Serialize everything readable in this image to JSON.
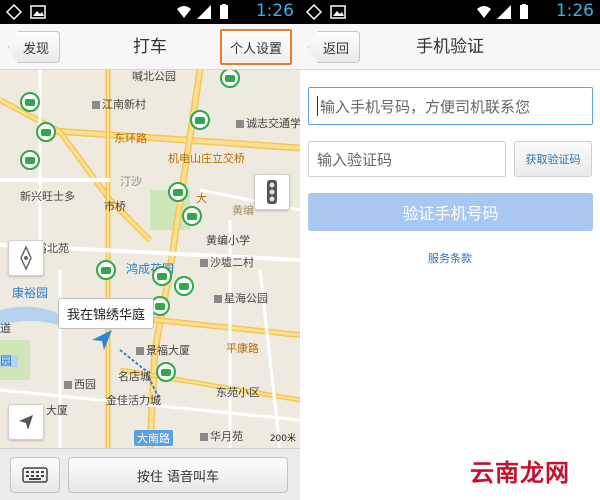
{
  "status_bar": {
    "time": "1:26"
  },
  "left_screen": {
    "nav": {
      "back_label": "发现",
      "title": "打车",
      "settings_label": "个人设置"
    },
    "map": {
      "labels": {
        "top_park": "喊北公园",
        "jiangnan": "江南新村",
        "dongpu": "东环路",
        "chengxin": "诚志交通学",
        "jidian": "机电山庄立交桥",
        "xingsha": "汀沙",
        "shiqiao": "市桥",
        "xinxing": "新兴旺士多",
        "huangbian": "黄编",
        "dasi": "大",
        "yubei": "裕北苑",
        "hongcheng": "鸿成花园",
        "huangbian_school": "黄编小学",
        "shatang": "沙墟二村",
        "kangyu": "康裕园",
        "xingdao": "星海公园",
        "dao": "道",
        "jingfu": "景福大厦",
        "pingkang": "平康路",
        "garden": "园",
        "xiyuan": "西园",
        "mingdian": "名店城",
        "dongyuan": "东苑小区",
        "dasha": "大厦",
        "jinjia": "金佳活力城",
        "danan": "大南路",
        "huayue": "华月苑",
        "scale": "200米"
      },
      "location_tooltip": "我在锦绣华庭"
    },
    "bottom": {
      "voice_label": "按住 语音叫车"
    }
  },
  "right_screen": {
    "nav": {
      "back_label": "返回",
      "title": "手机验证"
    },
    "form": {
      "phone_placeholder": "输入手机号码，方便司机联系您",
      "code_placeholder": "输入验证码",
      "get_code_label": "获取验证码",
      "verify_label": "验证手机号码",
      "terms_label": "服务条款"
    }
  },
  "watermark": "云南龙网",
  "colors": {
    "accent_blue": "#33b5e5",
    "taxi_green": "#2ea84a",
    "settings_border": "#f07b2b",
    "verify_disabled": "#a8c8f0",
    "link_blue": "#2a74b8",
    "watermark_red": "#c8102e"
  }
}
